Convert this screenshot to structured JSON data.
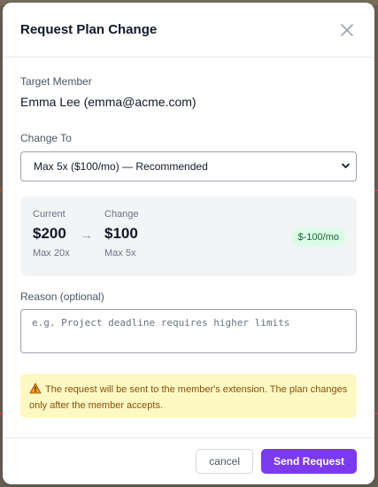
{
  "dialog": {
    "title": "Request Plan Change"
  },
  "target": {
    "label": "Target Member",
    "value": "Emma Lee (emma@acme.com)"
  },
  "change_to": {
    "label": "Change To",
    "selected": "Max 5x ($100/mo) — Recommended"
  },
  "comparison": {
    "current_label": "Current",
    "current_amount": "$200",
    "current_plan": "Max 20x",
    "arrow": "→",
    "change_label": "Change",
    "change_amount": "$100",
    "change_plan": "Max 5x",
    "delta": "$-100/mo"
  },
  "reason": {
    "label": "Reason (optional)",
    "placeholder": "e.g. Project deadline requires higher limits"
  },
  "notice": {
    "text": "The request will be sent to the member's extension. The plan changes only after the member accepts."
  },
  "footer": {
    "cancel_label": "cancel",
    "send_label": "Send Request"
  },
  "colors": {
    "accent": "#7c3aed",
    "warning_bg": "#fef9c3",
    "badge_bg": "#dcfce7"
  },
  "icons": {
    "close": "close-icon",
    "dropdown": "chevron-down-icon",
    "warning": "warning-icon"
  }
}
